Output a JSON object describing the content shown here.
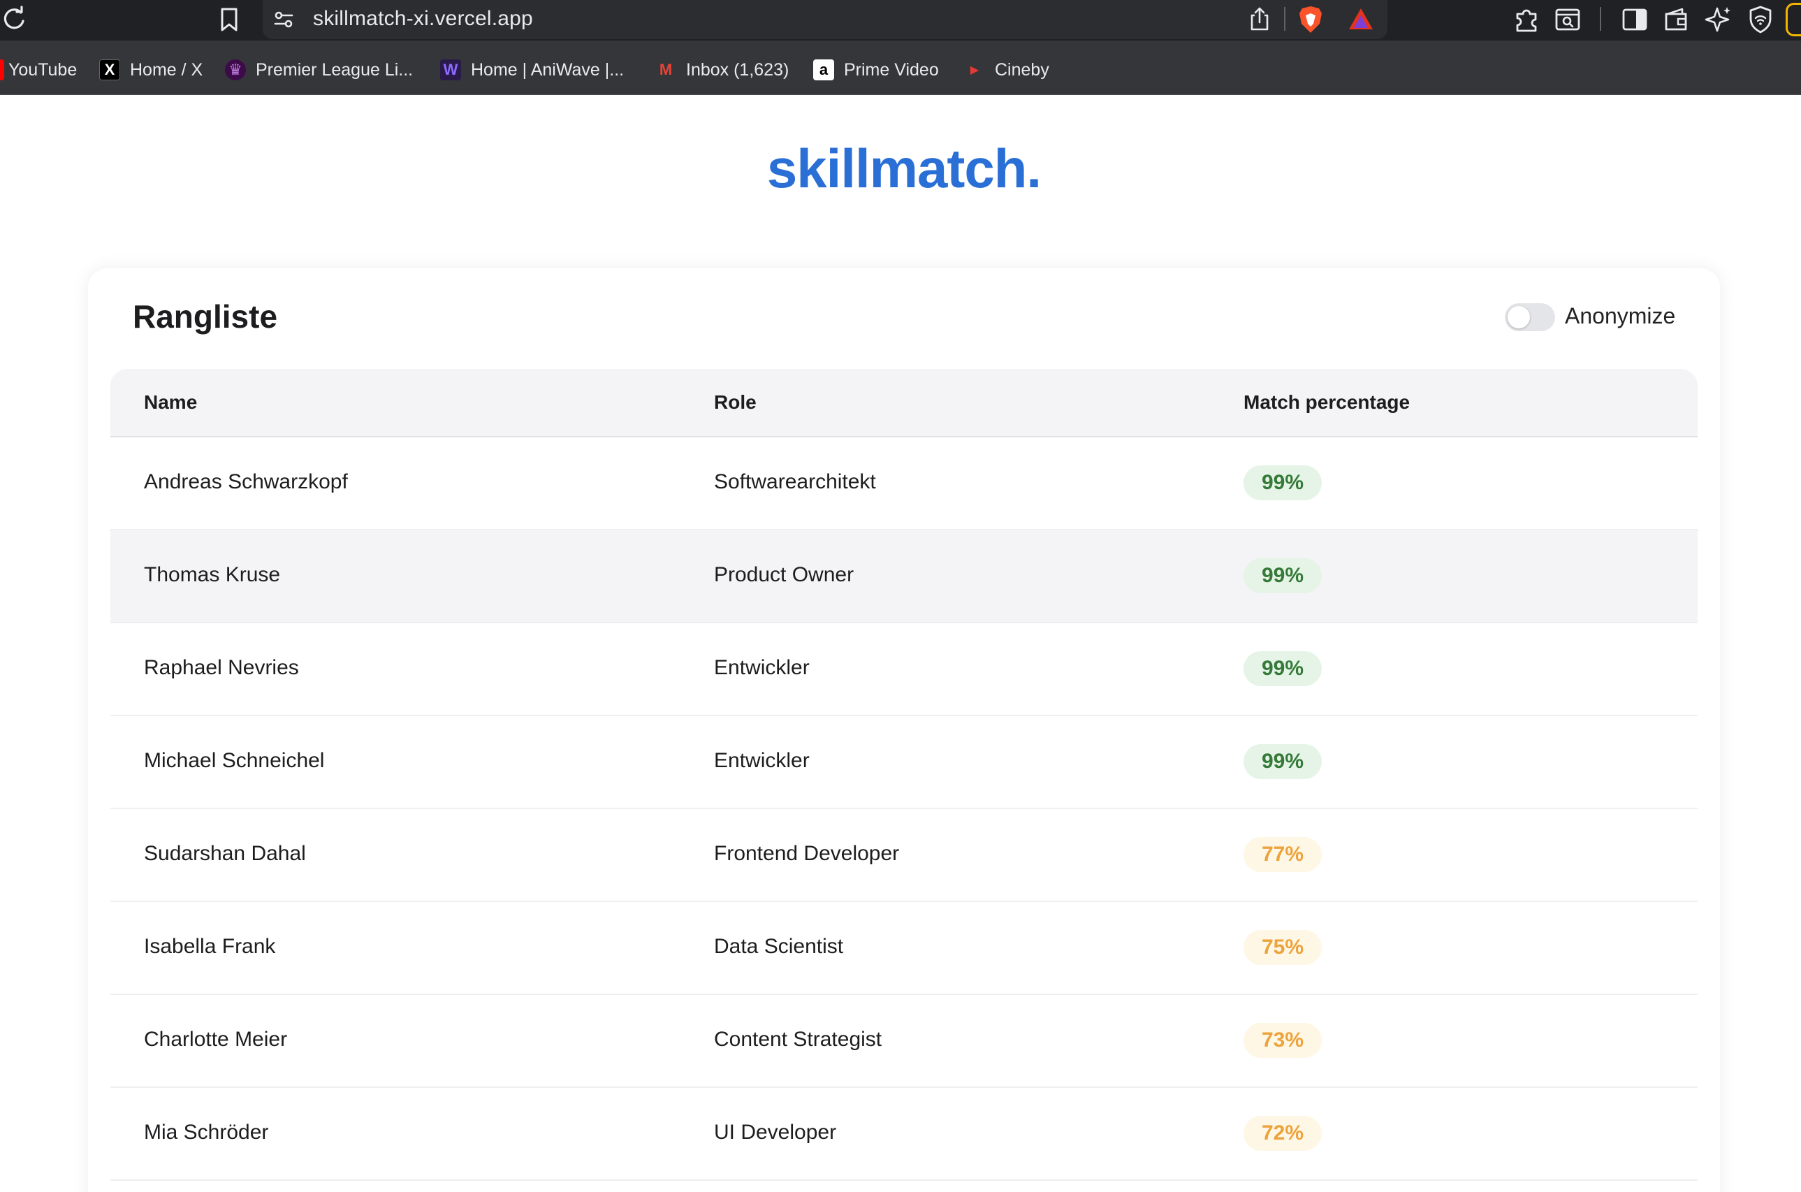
{
  "browser": {
    "url": "skillmatch-xi.vercel.app",
    "bookmarks": [
      {
        "label": "YouTube",
        "icon": "youtube-icon"
      },
      {
        "label": "Home / X",
        "icon": "x-icon"
      },
      {
        "label": "Premier League Li...",
        "icon": "premier-league-icon"
      },
      {
        "label": "Home | AniWave |...",
        "icon": "aniwave-icon"
      },
      {
        "label": "Inbox (1,623)",
        "icon": "gmail-icon"
      },
      {
        "label": "Prime Video",
        "icon": "amazon-icon"
      },
      {
        "label": "Cineby",
        "icon": "cineby-icon"
      }
    ]
  },
  "app": {
    "logo": "skillmatch."
  },
  "ranking": {
    "title": "Rangliste",
    "anonymize_label": "Anonymize",
    "anonymize_on": false,
    "columns": [
      "Name",
      "Role",
      "Match percentage"
    ],
    "rows": [
      {
        "name": "Andreas Schwarzkopf",
        "role": "Softwarearchitekt",
        "match": "99%",
        "level": "high"
      },
      {
        "name": "Thomas Kruse",
        "role": "Product Owner",
        "match": "99%",
        "level": "high"
      },
      {
        "name": "Raphael Nevries",
        "role": "Entwickler",
        "match": "99%",
        "level": "high"
      },
      {
        "name": "Michael Schneichel",
        "role": "Entwickler",
        "match": "99%",
        "level": "high"
      },
      {
        "name": "Sudarshan Dahal",
        "role": "Frontend Developer",
        "match": "77%",
        "level": "mid"
      },
      {
        "name": "Isabella Frank",
        "role": "Data Scientist",
        "match": "75%",
        "level": "mid"
      },
      {
        "name": "Charlotte Meier",
        "role": "Content Strategist",
        "match": "73%",
        "level": "mid"
      },
      {
        "name": "Mia Schröder",
        "role": "UI Developer",
        "match": "72%",
        "level": "mid"
      }
    ]
  },
  "colors": {
    "brand": "#2a6fd6",
    "match_high_text": "#357a38",
    "match_high_bg": "#e5f4e7",
    "match_mid_text": "#eda33b",
    "match_mid_bg": "#fff7e6"
  }
}
